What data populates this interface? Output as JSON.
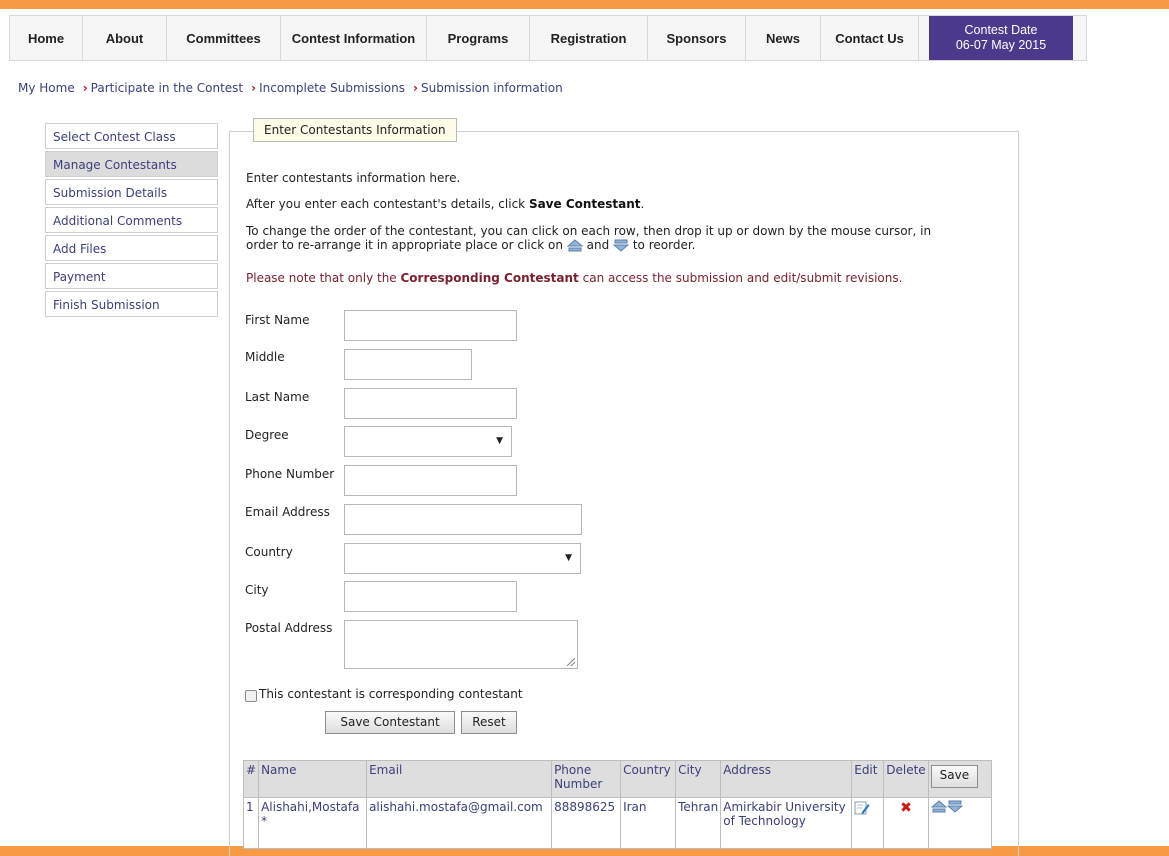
{
  "nav": {
    "items": [
      "Home",
      "About",
      "Committees",
      "Contest Information",
      "Programs",
      "Registration",
      "Sponsors",
      "News",
      "Contact Us"
    ],
    "contest_date_label": "Contest Date",
    "contest_date_value": "06-07 May 2015",
    "accent_color": "#4b3a8c"
  },
  "breadcrumb": [
    "My Home",
    "Participate in the Contest",
    "Incomplete Submissions",
    "Submission information"
  ],
  "sidebar": {
    "items": [
      "Select Contest Class",
      "Manage Contestants",
      "Submission Details",
      "Additional Comments",
      "Add Files",
      "Payment",
      "Finish Submission"
    ],
    "active": "Manage Contestants"
  },
  "panel": {
    "legend": "Enter Contestants Information",
    "intro": "Enter contestants information here.",
    "save_hint_prefix": "After you enter each contestant's details, click ",
    "save_hint_bold": "Save Contestant",
    "save_hint_suffix": ".",
    "reorder_line1": "To change the order of the contestant, you can click on each row, then drop it up or down by the mouse cursor, in",
    "reorder_line2_prefix": "order to re-arrange it in appropriate place or click on",
    "reorder_line2_and": "and",
    "reorder_line2_suffix": "to reorder.",
    "note_prefix": "Please note that only the ",
    "note_bold": "Corresponding Contestant",
    "note_suffix": " can access the submission and edit/submit revisions."
  },
  "form": {
    "first_name_label": "First Name",
    "middle_label": "Middle",
    "last_name_label": "Last Name",
    "degree_label": "Degree",
    "phone_label": "Phone Number",
    "email_label": "Email Address",
    "country_label": "Country",
    "city_label": "City",
    "postal_label": "Postal Address",
    "corresponding_label": "This contestant is corresponding contestant",
    "save_button": "Save Contestant",
    "reset_button": "Reset"
  },
  "table": {
    "headers": [
      "#",
      "Name",
      "Email",
      "Phone Number",
      "Country",
      "City",
      "Address",
      "Edit",
      "Delete"
    ],
    "save_button": "Save",
    "rows": [
      {
        "num": "1",
        "name": "Alishahi,Mostafa *",
        "email": "alishahi.mostafa@gmail.com",
        "phone": "88898625",
        "country": "Iran",
        "city": "Tehran",
        "address": "Amirkabir University of Technology"
      }
    ]
  }
}
